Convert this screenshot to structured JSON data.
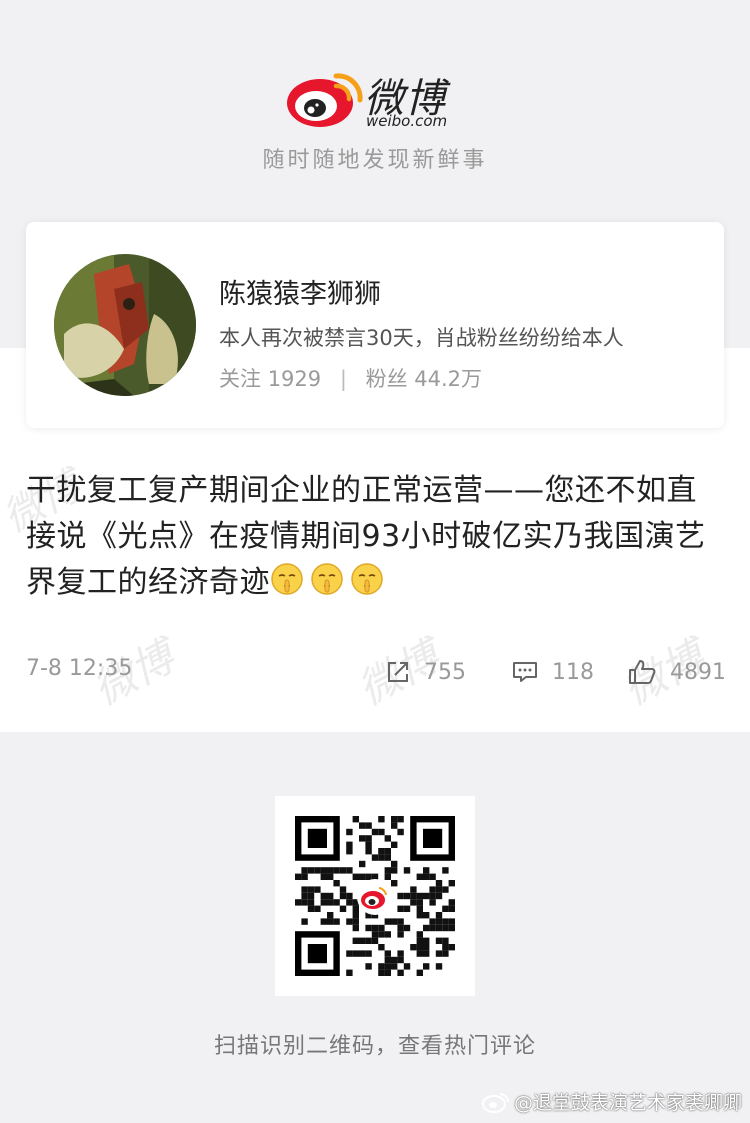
{
  "brand": {
    "name_zh": "微博",
    "domain": "weibo.com",
    "slogan": "随时随地发现新鲜事",
    "accent": "#e6162d",
    "accent2": "#f6a01a"
  },
  "profile": {
    "name": "陈猿猿李狮狮",
    "bio": "本人再次被禁言30天，肖战粉丝纷纷给本人",
    "following_label": "关注",
    "following_count": "1929",
    "followers_label": "粉丝",
    "followers_count": "44.2万"
  },
  "post": {
    "text": "干扰复工复产期间企业的正常运营——您还不如直接说《光点》在疫情期间93小时破亿实乃我国演艺界复工的经济奇迹",
    "emoji_count": 3,
    "emoji_name": "shush-emoji",
    "time": "7-8 12:35",
    "reposts": "755",
    "comments": "118",
    "likes": "4891"
  },
  "footer": {
    "qr_caption": "扫描识别二维码，查看热门评论",
    "credit": "@退堂鼓表演艺术家裘卿卿"
  },
  "icons": [
    "weibo-logo-icon",
    "repost-icon",
    "comment-icon",
    "like-icon",
    "weibo-small-icon"
  ]
}
